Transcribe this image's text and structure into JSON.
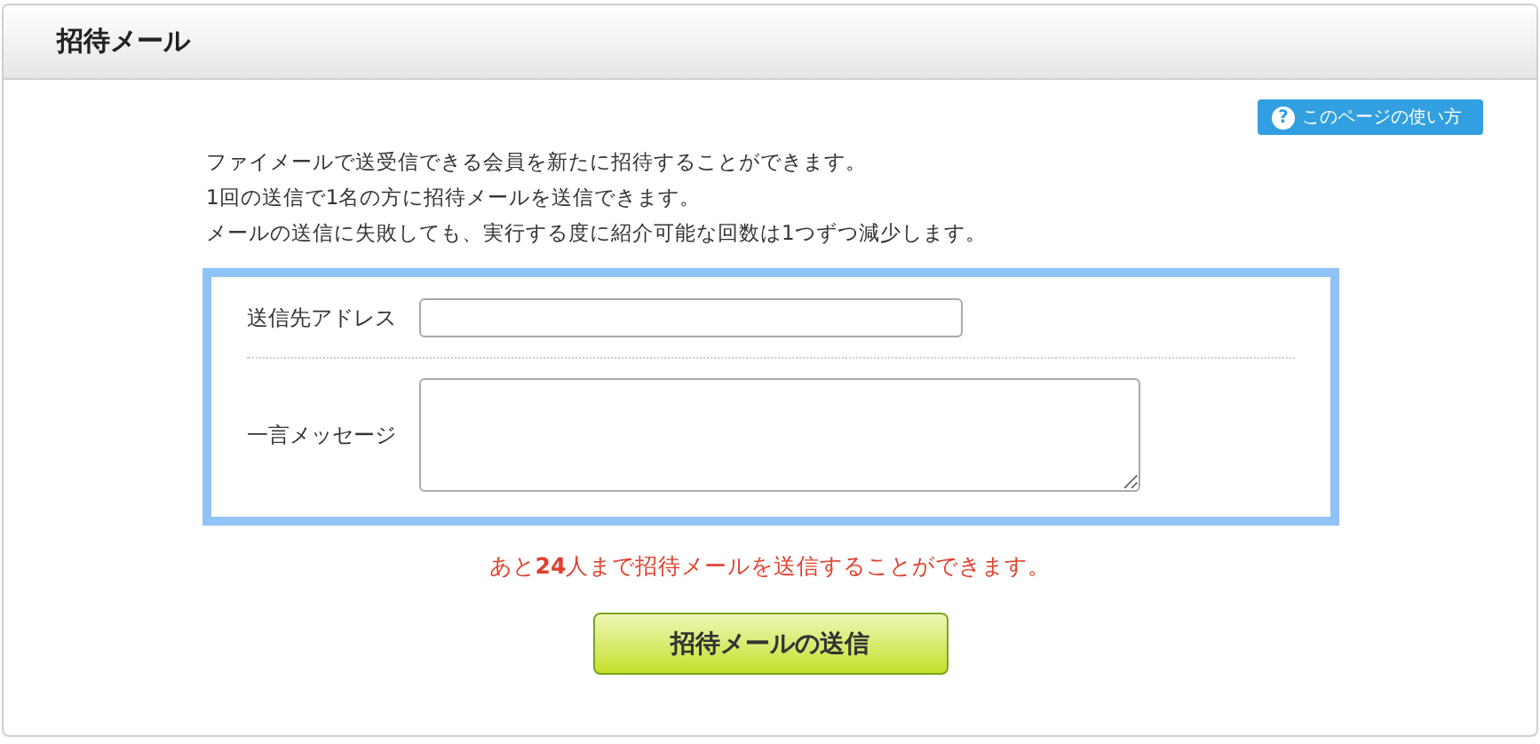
{
  "page_title": "招待メール",
  "help_button": {
    "label": "このページの使い方",
    "icon": "?"
  },
  "description": [
    "ファイメールで送受信できる会員を新たに招待することができます。",
    "1回の送信で1名の方に招待メールを送信できます。",
    "メールの送信に失敗しても、実行する度に紹介可能な回数は1つずつ減少します。"
  ],
  "form": {
    "fields": [
      {
        "label": "送信先アドレス",
        "kind": "input"
      },
      {
        "label": "一言メッセージ",
        "kind": "textarea"
      }
    ]
  },
  "notice": "あと**24**人まで招待メールを送信することができます。",
  "submit_button": "招待メールの送信"
}
